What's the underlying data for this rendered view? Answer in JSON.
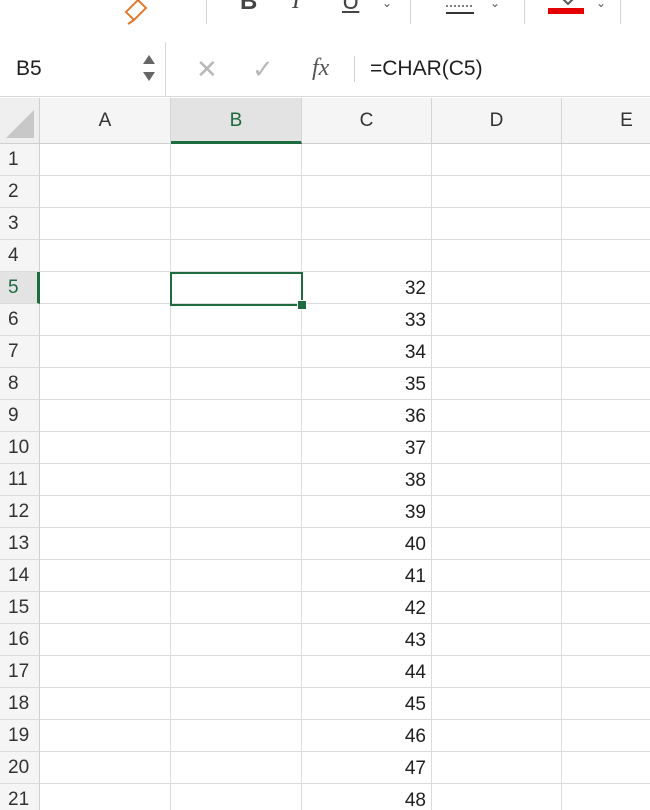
{
  "ribbon": {
    "bold_label": "B",
    "italic_label": "I",
    "underline_label": "U",
    "font_color_hex": "#e50000",
    "icons": [
      "format-painter-icon",
      "bold-icon",
      "italic-icon",
      "underline-icon",
      "borders-icon",
      "fill-color-icon"
    ]
  },
  "formula_bar": {
    "name_box": "B5",
    "cancel_icon": "✕",
    "enter_icon": "✓",
    "fx_label": "fx",
    "formula": "=CHAR(C5)"
  },
  "sheet": {
    "accent_color": "#1d6b3f",
    "columns": [
      "A",
      "B",
      "C",
      "D",
      "E"
    ],
    "active_column": "B",
    "rows": [
      "1",
      "2",
      "3",
      "4",
      "5",
      "6",
      "7",
      "8",
      "9",
      "10",
      "11",
      "12",
      "13",
      "14",
      "15",
      "16",
      "17",
      "18",
      "19",
      "20",
      "21"
    ],
    "active_row": "5",
    "selected_cell": "B5",
    "column_c_values": [
      "",
      "",
      "",
      "",
      "32",
      "33",
      "34",
      "35",
      "36",
      "37",
      "38",
      "39",
      "40",
      "41",
      "42",
      "43",
      "44",
      "45",
      "46",
      "47",
      "48"
    ]
  }
}
